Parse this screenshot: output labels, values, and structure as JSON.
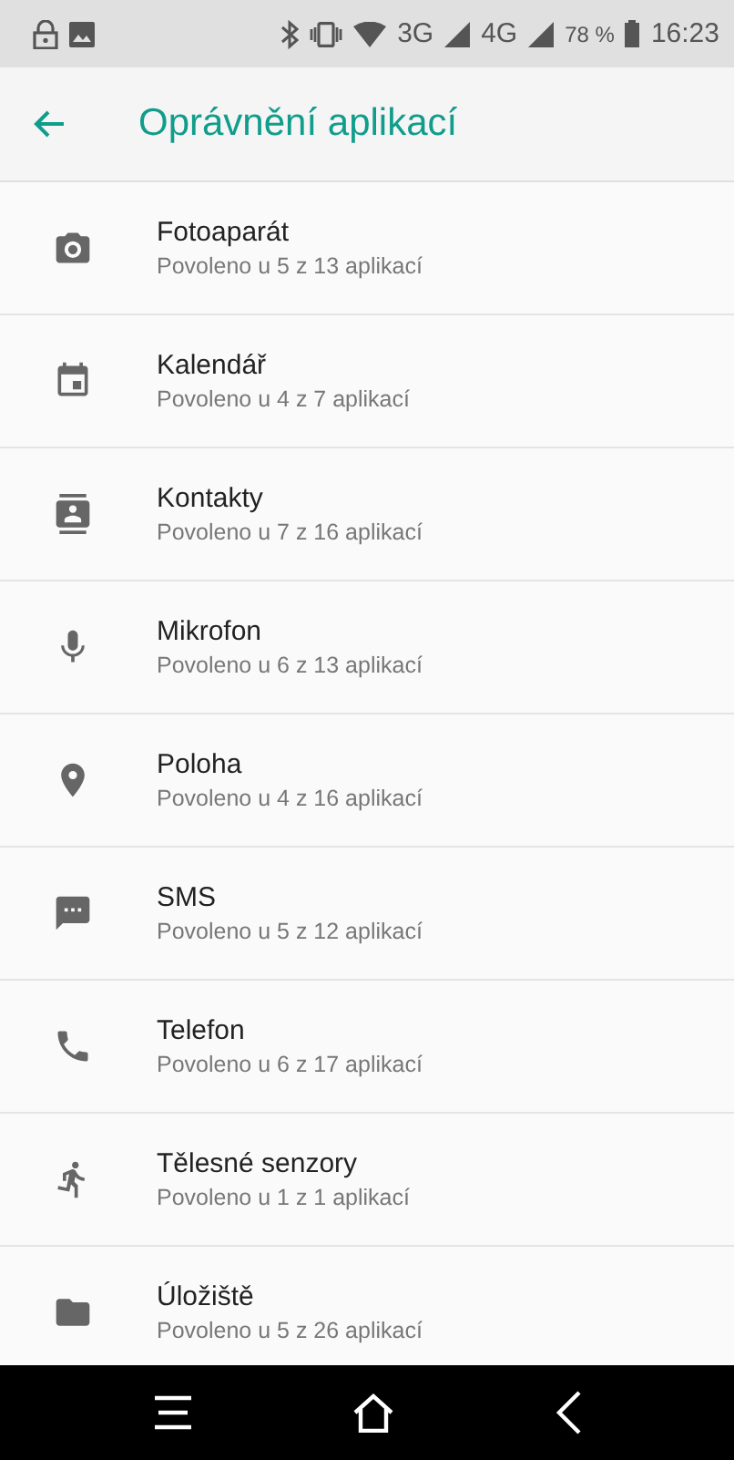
{
  "status_bar": {
    "network_1": "3G",
    "network_2": "4G",
    "battery": "78 %",
    "time": "16:23"
  },
  "app_bar": {
    "title": "Oprávnění aplikací"
  },
  "permissions": [
    {
      "kind": "camera",
      "name": "Fotoaparát",
      "summary": "Povoleno u 5 z 13 aplikací"
    },
    {
      "kind": "calendar",
      "name": "Kalendář",
      "summary": "Povoleno u 4 z 7 aplikací"
    },
    {
      "kind": "contacts",
      "name": "Kontakty",
      "summary": "Povoleno u 7 z 16 aplikací"
    },
    {
      "kind": "microphone",
      "name": "Mikrofon",
      "summary": "Povoleno u 6 z 13 aplikací"
    },
    {
      "kind": "location",
      "name": "Poloha",
      "summary": "Povoleno u 4 z 16 aplikací"
    },
    {
      "kind": "sms",
      "name": "SMS",
      "summary": "Povoleno u 5 z 12 aplikací"
    },
    {
      "kind": "phone",
      "name": "Telefon",
      "summary": "Povoleno u 6 z 17 aplikací"
    },
    {
      "kind": "sensors",
      "name": "Tělesné senzory",
      "summary": "Povoleno u 1 z 1 aplikací"
    },
    {
      "kind": "storage",
      "name": "Úložiště",
      "summary": "Povoleno u 5 z 26 aplikací"
    }
  ]
}
